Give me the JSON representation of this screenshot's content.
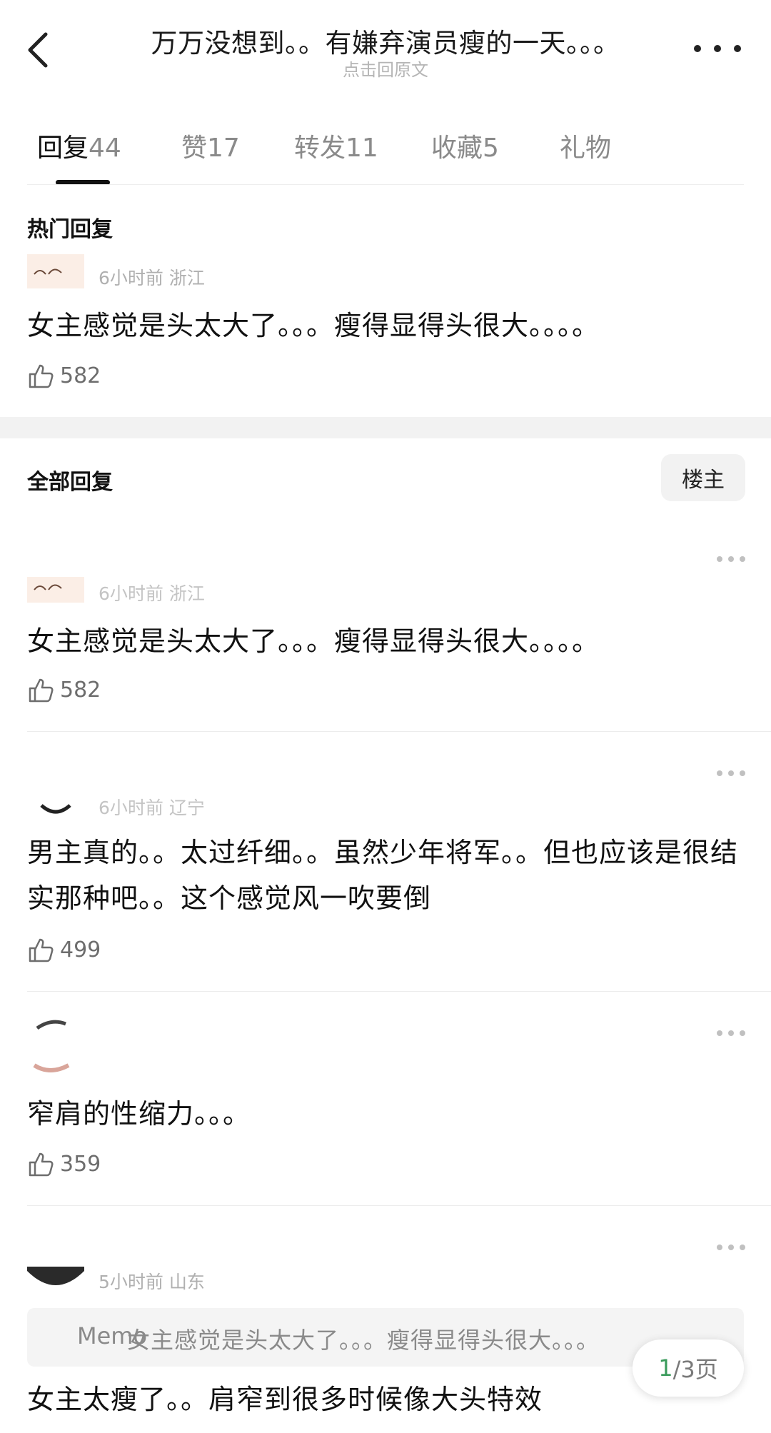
{
  "header": {
    "title": "万万没想到。。有嫌弃演员瘦的一天。。。",
    "subtitle": "点击回原文"
  },
  "tabs": [
    {
      "label": "回复",
      "count": "44"
    },
    {
      "label": "赞",
      "count": "17"
    },
    {
      "label": "转发",
      "count": "11"
    },
    {
      "label": "收藏",
      "count": "5"
    },
    {
      "label": "礼物",
      "count": ""
    }
  ],
  "hot": {
    "title": "热门回复",
    "comment": {
      "meta": "6小时前 浙江",
      "text": "女主感觉是头太大了。。。瘦得显得头很大。。。。",
      "likes": "582"
    }
  },
  "all": {
    "title": "全部回复",
    "filter_label": "楼主",
    "comments": [
      {
        "meta": "6小时前 浙江",
        "text": "女主感觉是头太大了。。。瘦得显得头很大。。。。",
        "likes": "582"
      },
      {
        "meta": "6小时前 辽宁",
        "text": "男主真的。。太过纤细。。虽然少年将军。。但也应该是很结实那种吧。。这个感觉风一吹要倒",
        "likes": "499"
      },
      {
        "meta": "",
        "text": "窄肩的性缩力。。。",
        "likes": "359"
      },
      {
        "meta": "5小时前 山东",
        "quote_prefix": "Memo",
        "quote": "女主感觉是头太大了。。。瘦得显得头很大。。。",
        "text": "女主太瘦了。。肩窄到很多时候像大头特效",
        "likes": ""
      }
    ]
  },
  "pager": {
    "current": "1",
    "rest": "/3页"
  },
  "colors": {
    "accent_green": "#3a9b5b",
    "tab_active": "#111111",
    "meta_gray": "#b0b0b0"
  }
}
